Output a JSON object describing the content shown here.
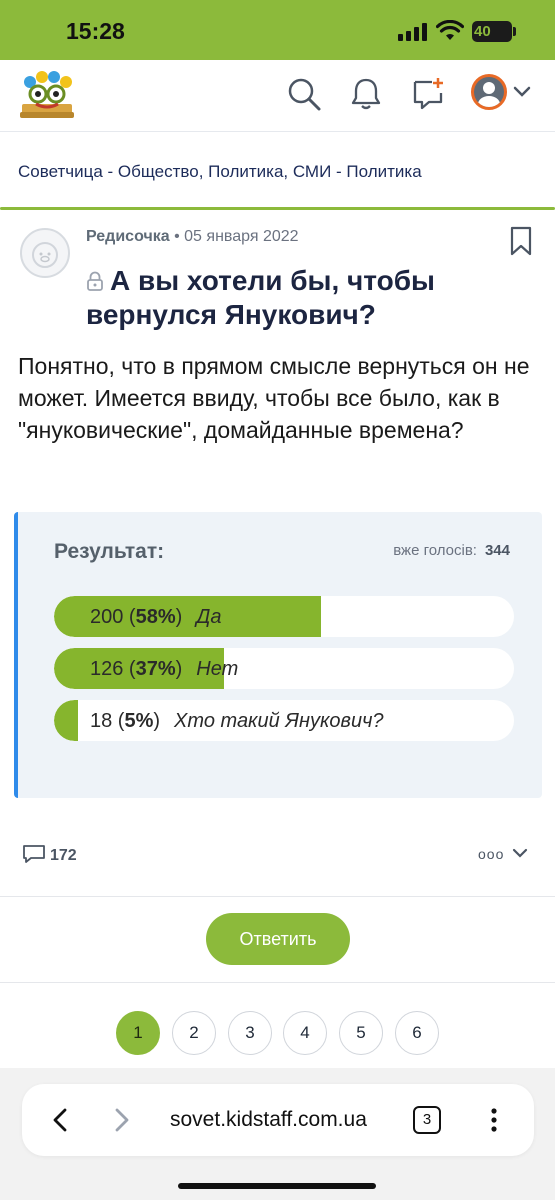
{
  "status_bar": {
    "time": "15:28",
    "battery": "40",
    "icons": [
      "signal-icon",
      "wifi-icon",
      "battery-icon"
    ]
  },
  "header": {
    "icons": [
      "logo",
      "search-icon",
      "bell-icon",
      "new-topic-icon",
      "avatar",
      "chevron-down-icon"
    ],
    "accent_color": "#8cba3b",
    "avatar_ring_color": "#e86a26"
  },
  "breadcrumb": {
    "text": "Советчица - Общество, Политика, СМИ - Политика"
  },
  "post": {
    "author": "Редисочка",
    "separator": "•",
    "date": "05 января 2022",
    "title": "А вы хотели бы, чтобы вернулся Янукович?",
    "body": "Понятно, что в прямом смысле вернуться он не может. Имеется ввиду, чтобы все было, как в \"януковические\", домайданные времена?"
  },
  "poll": {
    "title": "Результат:",
    "total_label": "вже голосів:",
    "total_value": "344",
    "options": [
      {
        "count": "200",
        "percent_label": "58%",
        "label": "Да",
        "fraction": 0.58
      },
      {
        "count": "126",
        "percent_label": "37%",
        "label": "Нет",
        "fraction": 0.37
      },
      {
        "count": "18",
        "percent_label": "5%",
        "label": "Хто такий Янукович?",
        "fraction": 0.05
      }
    ],
    "fill_color": "#86b52d",
    "border_color": "#2f8bea"
  },
  "post_footer": {
    "comment_count": "172",
    "more_label": "ooo"
  },
  "reply_button": {
    "label": "Ответить"
  },
  "pagination": {
    "pages": [
      "1",
      "2",
      "3",
      "4",
      "5",
      "6"
    ],
    "active": "1"
  },
  "browser": {
    "url": "sovet.kidstaff.com.ua",
    "tab_count": "3"
  }
}
